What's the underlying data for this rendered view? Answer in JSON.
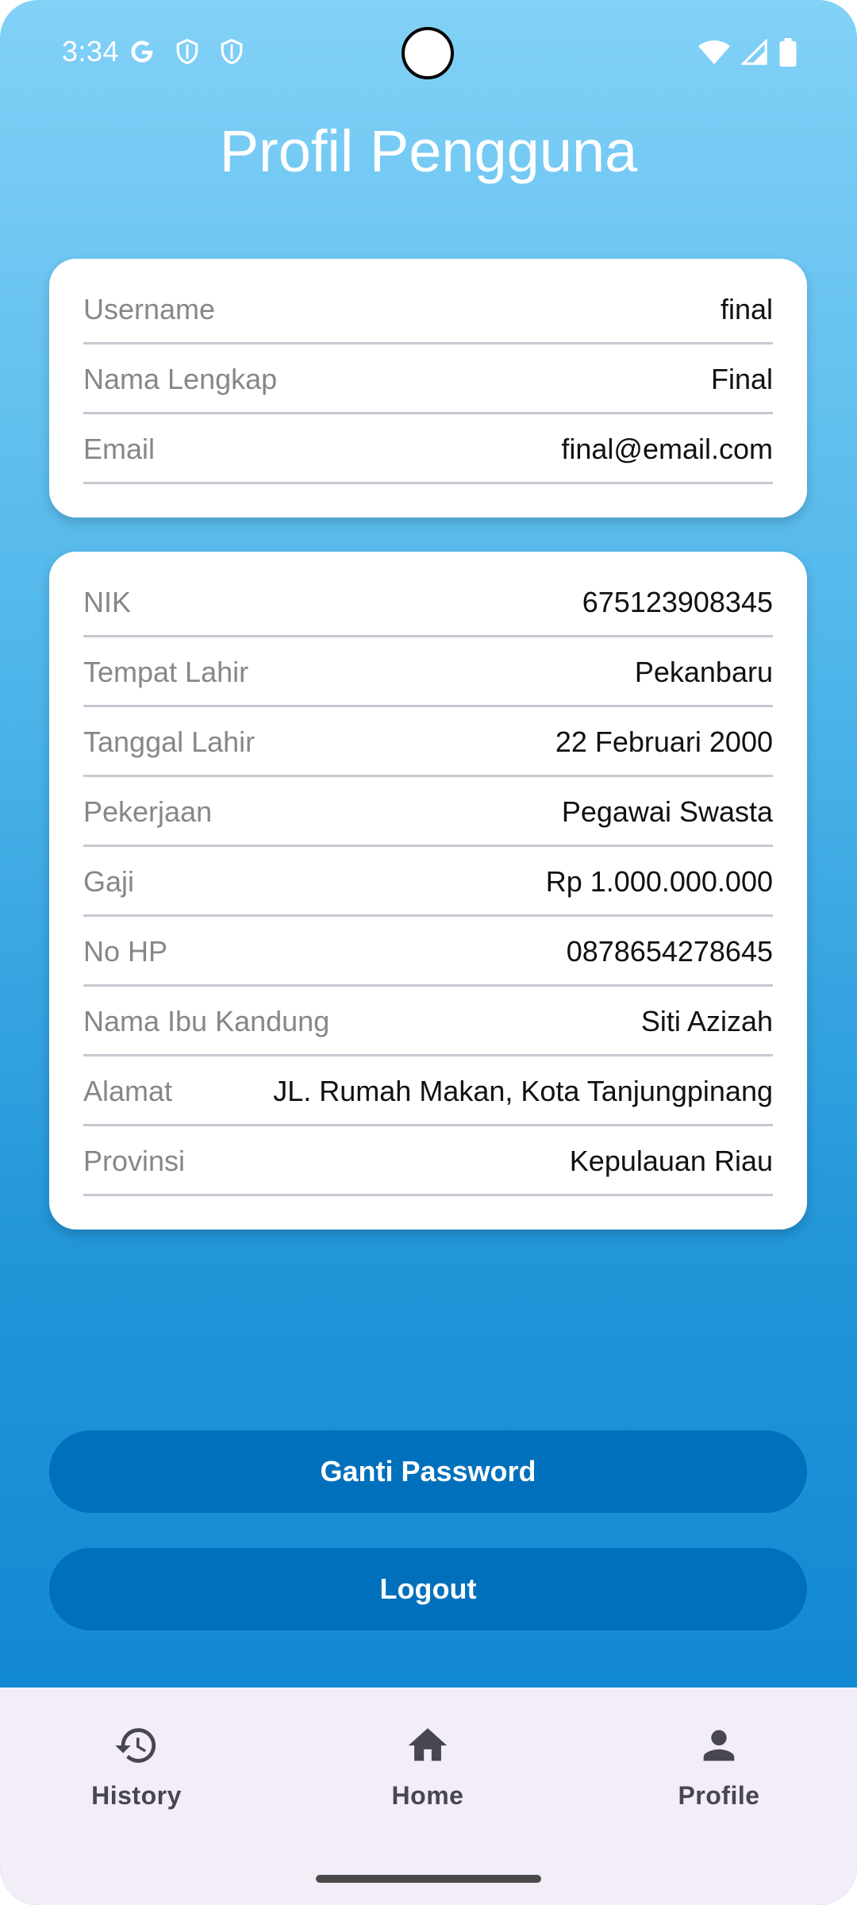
{
  "status_bar": {
    "time": "3:34",
    "left_icons": [
      "google-icon",
      "shield-icon",
      "shield-icon"
    ],
    "right_icons": [
      "wifi-icon",
      "signal-icon",
      "battery-icon"
    ]
  },
  "page_title": "Profil Pengguna",
  "account_card": {
    "rows": [
      {
        "label": "Username",
        "value": "final"
      },
      {
        "label": "Nama Lengkap",
        "value": "Final"
      },
      {
        "label": "Email",
        "value": "final@email.com"
      }
    ]
  },
  "detail_card": {
    "rows": [
      {
        "label": "NIK",
        "value": "675123908345"
      },
      {
        "label": "Tempat Lahir",
        "value": "Pekanbaru"
      },
      {
        "label": "Tanggal Lahir",
        "value": "22 Februari 2000"
      },
      {
        "label": "Pekerjaan",
        "value": "Pegawai Swasta"
      },
      {
        "label": "Gaji",
        "value": "Rp 1.000.000.000"
      },
      {
        "label": "No HP",
        "value": "0878654278645"
      },
      {
        "label": "Nama Ibu Kandung",
        "value": "Siti Azizah"
      },
      {
        "label": "Alamat",
        "value": "JL. Rumah Makan, Kota Tanjungpinang"
      },
      {
        "label": "Provinsi",
        "value": "Kepulauan Riau"
      }
    ]
  },
  "buttons": {
    "change_password": "Ganti Password",
    "logout": "Logout"
  },
  "bottom_nav": {
    "items": [
      {
        "label": "History",
        "icon": "history-icon"
      },
      {
        "label": "Home",
        "icon": "home-icon"
      },
      {
        "label": "Profile",
        "icon": "profile-icon"
      }
    ]
  },
  "colors": {
    "gradient_top": "#82d1f7",
    "gradient_bottom": "#0a83cf",
    "button": "#0070bc",
    "nav_background": "#f2edf7"
  }
}
